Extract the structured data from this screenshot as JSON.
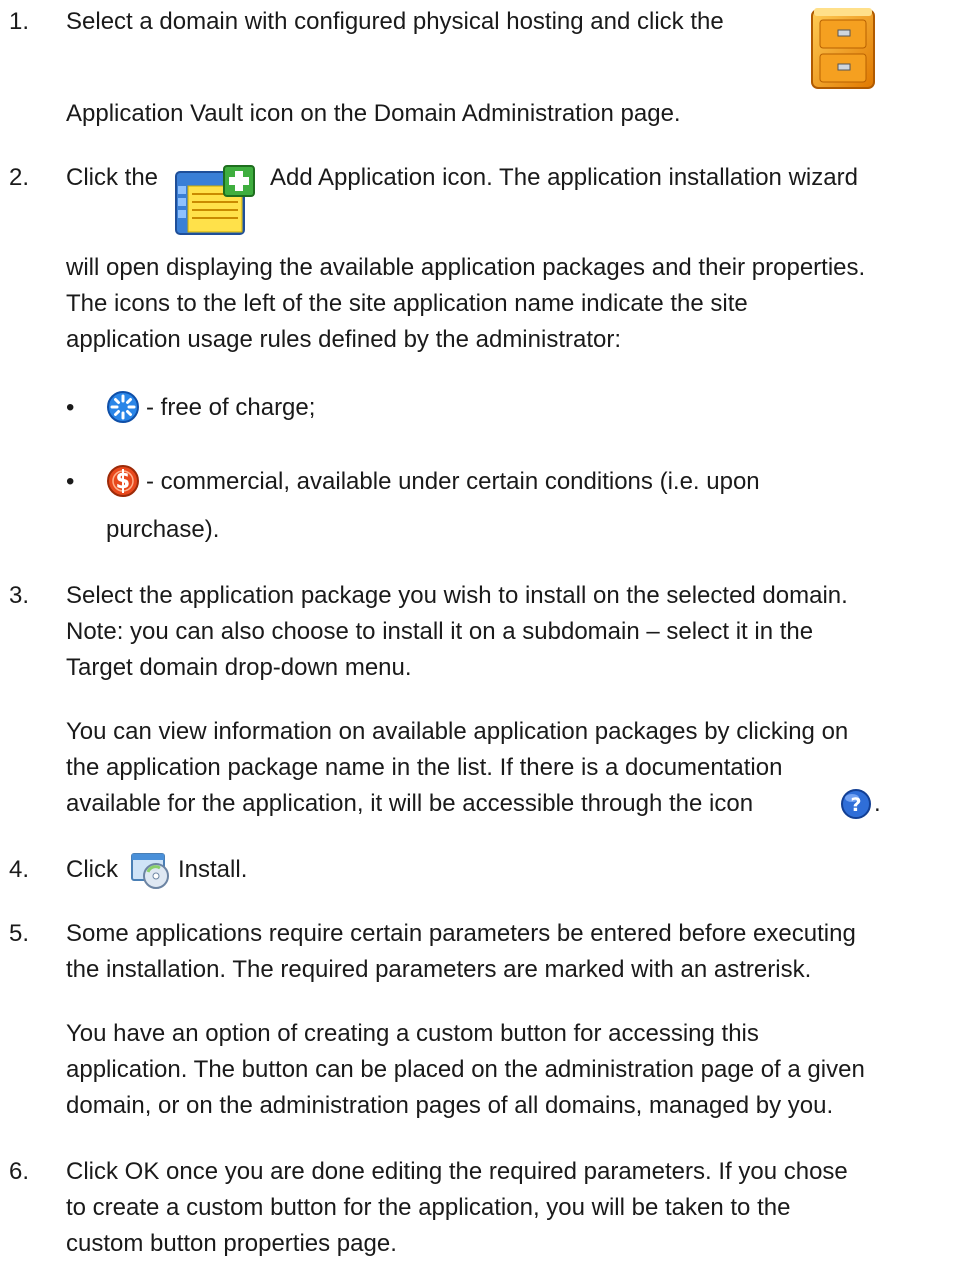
{
  "steps": [
    {
      "number": "1.",
      "line1": "Select a domain with configured physical hosting and click the",
      "line2": "Application Vault icon on the Domain Administration page.",
      "icon": "application-vault-icon"
    },
    {
      "number": "2.",
      "pre": "Click the",
      "post": "Add Application icon. The application installation wizard",
      "icon": "add-application-icon",
      "lines": [
        "will open displaying the available application packages and their properties.",
        "The icons to the left of the site application name indicate the site",
        "application usage rules defined by the administrator:"
      ],
      "bullets": [
        {
          "symbol": "•",
          "icon": "free-icon",
          "text": "- free of charge;"
        },
        {
          "symbol": "•",
          "icon": "commercial-icon",
          "text": "- commercial, available under certain conditions (i.e. upon",
          "text2": "purchase)."
        }
      ]
    },
    {
      "number": "3.",
      "lines": [
        "Select the application package you wish to install on the selected domain.",
        "Note: you can also choose to install it on a subdomain – select it in the",
        "Target domain drop-down menu."
      ],
      "para2": [
        "You can view information on available application packages by clicking on",
        "the application package name in the list. If there is a documentation"
      ],
      "para2_last": "available for the application, it will be accessible through the icon",
      "para2_end": ".",
      "icon": "help-icon"
    },
    {
      "number": "4.",
      "pre": "Click",
      "post": "Install.",
      "icon": "install-icon"
    },
    {
      "number": "5.",
      "lines": [
        "Some applications require certain parameters be entered before executing",
        "the installation. The required parameters are marked with an astrerisk."
      ],
      "para2": [
        "You have an option of creating a custom button for accessing this",
        "application. The button can be placed on the administration page of a given",
        "domain, or on the administration pages of all domains, managed by you."
      ]
    },
    {
      "number": "6.",
      "lines": [
        "Click OK once you are done editing the required parameters. If you chose",
        "to create a custom button for the application, you will be taken to the",
        "custom button properties page."
      ]
    }
  ]
}
